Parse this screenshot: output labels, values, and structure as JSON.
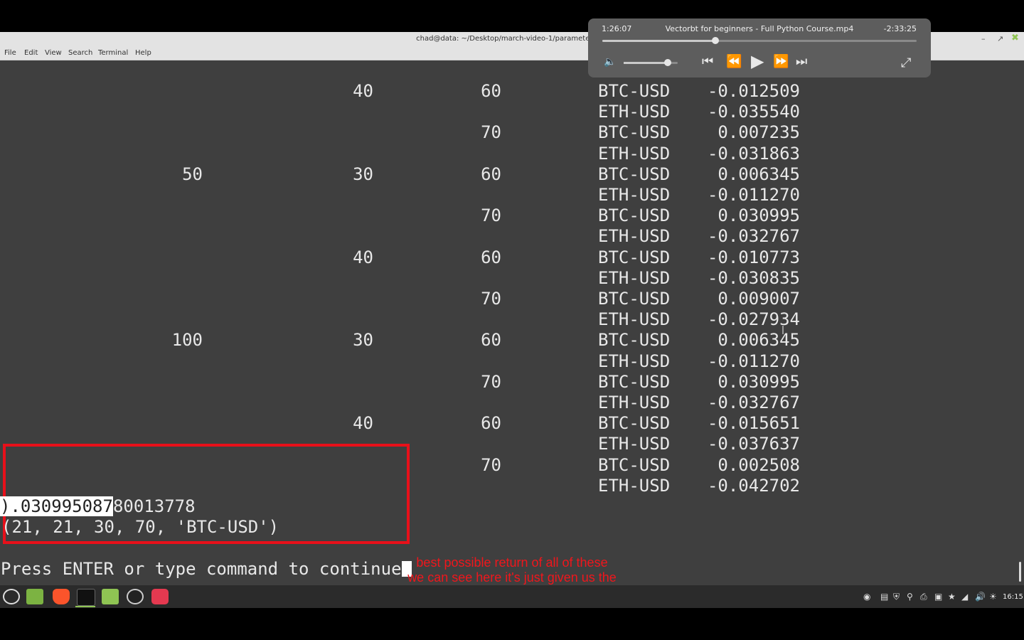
{
  "window": {
    "title": "chad@data: ~/Desktop/march-video-1/parameter_opt",
    "menu": [
      "File",
      "Edit",
      "View",
      "Search",
      "Terminal",
      "Help"
    ]
  },
  "terminal": {
    "rows": [
      {
        "a": "",
        "b": "40",
        "c": "60",
        "sym": "BTC-USD",
        "val": "-0.012509"
      },
      {
        "a": "",
        "b": "",
        "c": "",
        "sym": "ETH-USD",
        "val": "-0.035540"
      },
      {
        "a": "",
        "b": "",
        "c": "70",
        "sym": "BTC-USD",
        "val": "0.007235"
      },
      {
        "a": "",
        "b": "",
        "c": "",
        "sym": "ETH-USD",
        "val": "-0.031863"
      },
      {
        "a": "50",
        "b": "30",
        "c": "60",
        "sym": "BTC-USD",
        "val": "0.006345"
      },
      {
        "a": "",
        "b": "",
        "c": "",
        "sym": "ETH-USD",
        "val": "-0.011270"
      },
      {
        "a": "",
        "b": "",
        "c": "70",
        "sym": "BTC-USD",
        "val": "0.030995"
      },
      {
        "a": "",
        "b": "",
        "c": "",
        "sym": "ETH-USD",
        "val": "-0.032767"
      },
      {
        "a": "",
        "b": "40",
        "c": "60",
        "sym": "BTC-USD",
        "val": "-0.010773"
      },
      {
        "a": "",
        "b": "",
        "c": "",
        "sym": "ETH-USD",
        "val": "-0.030835"
      },
      {
        "a": "",
        "b": "",
        "c": "70",
        "sym": "BTC-USD",
        "val": "0.009007"
      },
      {
        "a": "",
        "b": "",
        "c": "",
        "sym": "ETH-USD",
        "val": "-0.027934"
      },
      {
        "a": "100",
        "b": "30",
        "c": "60",
        "sym": "BTC-USD",
        "val": "0.006345"
      },
      {
        "a": "",
        "b": "",
        "c": "",
        "sym": "ETH-USD",
        "val": "-0.011270"
      },
      {
        "a": "",
        "b": "",
        "c": "70",
        "sym": "BTC-USD",
        "val": "0.030995"
      },
      {
        "a": "",
        "b": "",
        "c": "",
        "sym": "ETH-USD",
        "val": "-0.032767"
      },
      {
        "a": "",
        "b": "40",
        "c": "60",
        "sym": "BTC-USD",
        "val": "-0.015651"
      },
      {
        "a": "",
        "b": "",
        "c": "",
        "sym": "ETH-USD",
        "val": "-0.037637"
      },
      {
        "a": "",
        "b": "",
        "c": "70",
        "sym": "BTC-USD",
        "val": "0.002508"
      },
      {
        "a": "",
        "b": "",
        "c": "",
        "sym": "ETH-USD",
        "val": "-0.042702"
      }
    ],
    "result_selected": ").030995087",
    "result_rest": "80013778",
    "result_params": "(21, 21, 30, 70, 'BTC-USD')",
    "prompt": "Press ENTER or type command to continue"
  },
  "subtitles": {
    "line1": "best possible return of all of these",
    "line2": "we can see here it's just given us the"
  },
  "player": {
    "elapsed": "1:26:07",
    "title": "Vectorbt for beginners - Full Python Course.mp4",
    "remaining": "-2:33:25",
    "progress": 0.36,
    "volume": 0.82
  },
  "taskbar": {
    "clock": "16:15",
    "apps": [
      "menu-icon",
      "files-icon",
      "brave-icon",
      "terminal-icon",
      "folder-icon",
      "obs-icon",
      "image-viewer-icon"
    ]
  },
  "colors": {
    "terminal_bg": "#3f3f3f",
    "annotation_red": "#e8101a",
    "subtitle_red": "#f0161c"
  }
}
